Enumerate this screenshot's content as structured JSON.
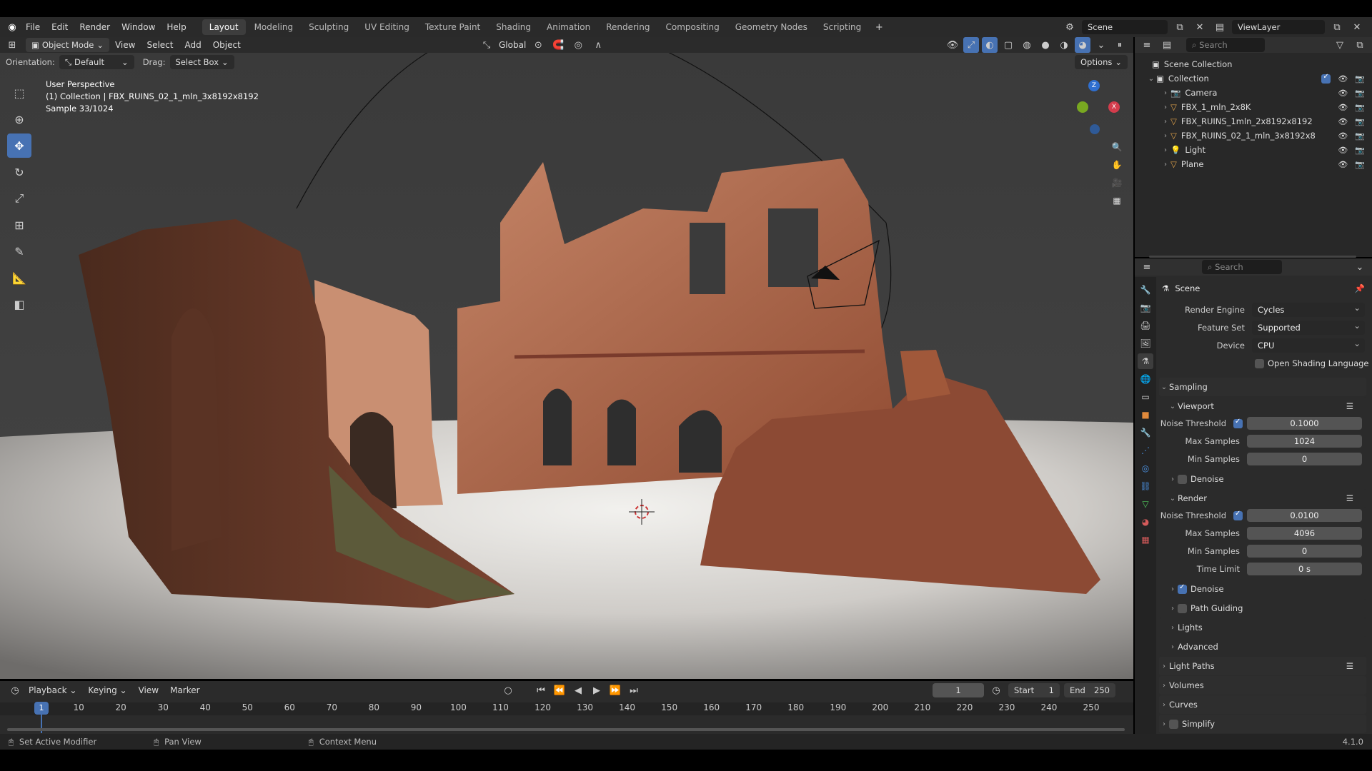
{
  "menu": {
    "file": "File",
    "edit": "Edit",
    "render": "Render",
    "window": "Window",
    "help": "Help"
  },
  "workspaces": [
    "Layout",
    "Modeling",
    "Sculpting",
    "UV Editing",
    "Texture Paint",
    "Shading",
    "Animation",
    "Rendering",
    "Compositing",
    "Geometry Nodes",
    "Scripting"
  ],
  "active_workspace": "Layout",
  "scene_name": "Scene",
  "view_layer": "ViewLayer",
  "viewport_header": {
    "mode": "Object Mode",
    "view": "View",
    "select": "Select",
    "add": "Add",
    "object": "Object",
    "transform": "Global"
  },
  "tool_settings": {
    "orientation_label": "Orientation:",
    "orientation_value": "Default",
    "drag_label": "Drag:",
    "drag_value": "Select Box",
    "options": "Options"
  },
  "overlay_text": {
    "line1": "User Perspective",
    "line2": "(1) Collection | FBX_RUINS_02_1_mln_3x8192x8192",
    "line3": "Sample 33/1024"
  },
  "gizmo": {
    "z": "Z",
    "x": "X"
  },
  "outliner": {
    "search_placeholder": "Search",
    "scene_collection": "Scene Collection",
    "collection": "Collection",
    "items": [
      {
        "name": "Camera",
        "icon": "camera-icon"
      },
      {
        "name": "FBX_1_mln_2x8K",
        "icon": "mesh-icon"
      },
      {
        "name": "FBX_RUINS_1mln_2x8192x8192",
        "icon": "mesh-icon"
      },
      {
        "name": "FBX_RUINS_02_1_mln_3x8192x8",
        "icon": "mesh-icon"
      },
      {
        "name": "Light",
        "icon": "light-icon"
      },
      {
        "name": "Plane",
        "icon": "mesh-icon"
      }
    ]
  },
  "properties": {
    "search_placeholder": "Search",
    "context": "Scene",
    "render_engine_label": "Render Engine",
    "render_engine": "Cycles",
    "feature_set_label": "Feature Set",
    "feature_set": "Supported",
    "device_label": "Device",
    "device": "CPU",
    "osl_label": "Open Shading Language",
    "sampling": "Sampling",
    "viewport": "Viewport",
    "noise_threshold_label": "Noise Threshold",
    "viewport_noise_threshold": "0.1000",
    "max_samples_label": "Max Samples",
    "viewport_max_samples": "1024",
    "min_samples_label": "Min Samples",
    "viewport_min_samples": "0",
    "denoise": "Denoise",
    "render": "Render",
    "render_noise_threshold": "0.0100",
    "render_max_samples": "4096",
    "render_min_samples": "0",
    "time_limit_label": "Time Limit",
    "time_limit": "0 s",
    "path_guiding": "Path Guiding",
    "lights": "Lights",
    "advanced": "Advanced",
    "light_paths": "Light Paths",
    "volumes": "Volumes",
    "curves": "Curves",
    "simplify": "Simplify"
  },
  "timeline": {
    "playback": "Playback",
    "keying": "Keying",
    "view": "View",
    "marker": "Marker",
    "current_frame": "1",
    "start_label": "Start",
    "start": "1",
    "end_label": "End",
    "end": "250",
    "ticks": [
      "10",
      "20",
      "30",
      "40",
      "50",
      "60",
      "70",
      "80",
      "90",
      "100",
      "110",
      "120",
      "130",
      "140",
      "150",
      "160",
      "170",
      "180",
      "190",
      "200",
      "210",
      "220",
      "230",
      "240",
      "250"
    ],
    "playhead": "1"
  },
  "statusbar": {
    "left": "Set Active Modifier",
    "middle": "Pan View",
    "right": "Context Menu",
    "version": "4.1.0"
  },
  "colors": {
    "accent": "#4772b3",
    "brick": "#a0583a",
    "floor": "#d9d6d2"
  }
}
